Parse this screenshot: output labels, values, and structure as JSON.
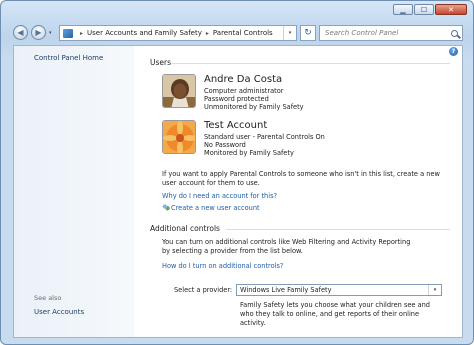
{
  "window": {
    "caption": {
      "minimize": "▁",
      "maximize": "☐",
      "close": "✕"
    }
  },
  "nav": {
    "back_glyph": "◀",
    "forward_glyph": "▶",
    "history_glyph": "▾",
    "breadcrumb": [
      "User Accounts and Family Safety",
      "Parental Controls"
    ],
    "separator": "▸",
    "dropdown_glyph": "▾",
    "refresh_glyph": "↻",
    "search_placeholder": "Search Control Panel"
  },
  "left_pane": {
    "home_link": "Control Panel Home",
    "see_also_label": "See also",
    "see_also_links": [
      "User Accounts"
    ]
  },
  "users_section": {
    "title": "Users",
    "users": [
      {
        "name": "Andre Da Costa",
        "lines": [
          "Computer administrator",
          "Password protected",
          "Unmonitored by Family Safety"
        ],
        "avatar": "person-photo"
      },
      {
        "name": "Test Account",
        "lines": [
          "Standard user - Parental Controls On",
          "No Password",
          "Monitored by Family Safety"
        ],
        "avatar": "orange-flower"
      }
    ],
    "info_text": "If you want to apply Parental Controls to someone who isn't in this list, create a new user account for them to use.",
    "why_link": "Why do I need an account for this?",
    "create_link": "Create a new user account"
  },
  "additional_section": {
    "title": "Additional controls",
    "info_text": "You can turn on additional controls like Web Filtering and Activity Reporting by selecting a provider from the list below.",
    "how_link": "How do I turn on additional controls?",
    "provider_label": "Select a provider:",
    "provider_value": "Windows Live Family Safety",
    "provider_desc": "Family Safety lets you choose what your children see and who they talk to online, and get reports of their online activity."
  },
  "help_glyph": "?"
}
